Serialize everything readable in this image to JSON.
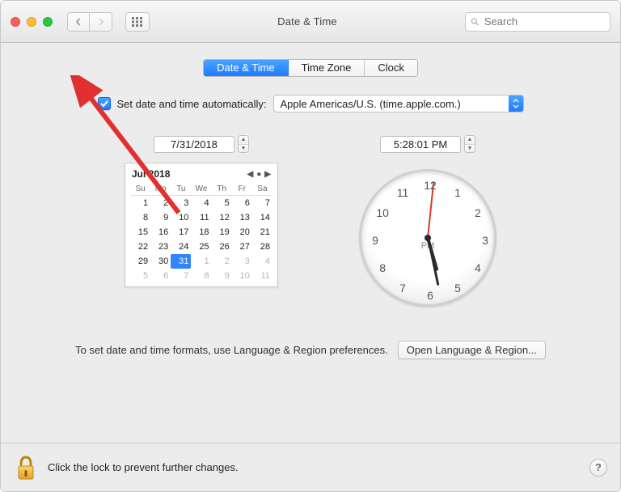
{
  "window": {
    "title": "Date & Time"
  },
  "search": {
    "placeholder": "Search"
  },
  "tabs": {
    "date_time": "Date & Time",
    "time_zone": "Time Zone",
    "clock": "Clock",
    "active": 0
  },
  "auto": {
    "label": "Set date and time automatically:",
    "checked": true,
    "server": "Apple Americas/U.S. (time.apple.com.)"
  },
  "date_field": "7/31/2018",
  "time_field": "5:28:01 PM",
  "calendar": {
    "month_label": "Jul 2018",
    "dow": [
      "Su",
      "Mo",
      "Tu",
      "We",
      "Th",
      "Fr",
      "Sa"
    ],
    "weeks": [
      [
        {
          "d": 1
        },
        {
          "d": 2
        },
        {
          "d": 3
        },
        {
          "d": 4
        },
        {
          "d": 5
        },
        {
          "d": 6
        },
        {
          "d": 7
        }
      ],
      [
        {
          "d": 8
        },
        {
          "d": 9
        },
        {
          "d": 10
        },
        {
          "d": 11
        },
        {
          "d": 12
        },
        {
          "d": 13
        },
        {
          "d": 14
        }
      ],
      [
        {
          "d": 15
        },
        {
          "d": 16
        },
        {
          "d": 17
        },
        {
          "d": 18
        },
        {
          "d": 19
        },
        {
          "d": 20
        },
        {
          "d": 21
        }
      ],
      [
        {
          "d": 22
        },
        {
          "d": 23
        },
        {
          "d": 24
        },
        {
          "d": 25
        },
        {
          "d": 26
        },
        {
          "d": 27
        },
        {
          "d": 28
        }
      ],
      [
        {
          "d": 29
        },
        {
          "d": 30
        },
        {
          "d": 31,
          "sel": true
        },
        {
          "d": 1,
          "out": true
        },
        {
          "d": 2,
          "out": true
        },
        {
          "d": 3,
          "out": true
        },
        {
          "d": 4,
          "out": true
        }
      ],
      [
        {
          "d": 5,
          "out": true
        },
        {
          "d": 6,
          "out": true
        },
        {
          "d": 7,
          "out": true
        },
        {
          "d": 8,
          "out": true
        },
        {
          "d": 9,
          "out": true
        },
        {
          "d": 10,
          "out": true
        },
        {
          "d": 11,
          "out": true
        }
      ]
    ]
  },
  "clock": {
    "ampm": "PM",
    "hour_angle": 164,
    "minute_angle": 168,
    "second_angle": 6,
    "numbers": [
      "12",
      "1",
      "2",
      "3",
      "4",
      "5",
      "6",
      "7",
      "8",
      "9",
      "10",
      "11"
    ]
  },
  "formats_hint": "To set date and time formats, use Language & Region preferences.",
  "open_lang_region": "Open Language & Region...",
  "lock_hint": "Click the lock to prevent further changes.",
  "help": "?"
}
